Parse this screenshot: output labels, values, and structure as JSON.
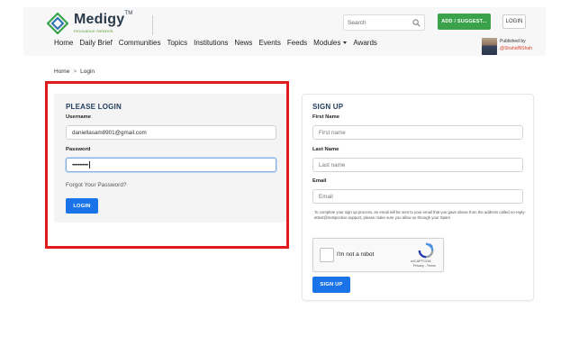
{
  "header": {
    "logo_name": "Medigy",
    "logo_tm": "TM",
    "logo_tagline": "Innovation Network",
    "search_placeholder": "Search",
    "add_button": "ADD / SUGGEST...",
    "login_button": "LOGIN",
    "nav": [
      "Home",
      "Daily Brief",
      "Communities",
      "Topics",
      "Institutions",
      "News",
      "Events",
      "Feeds",
      "Modules",
      "Awards"
    ],
    "published_by": "Published by",
    "author": "@ShahidNShah"
  },
  "breadcrumb": {
    "home": "Home",
    "separator": ">",
    "current": "Login"
  },
  "login": {
    "title": "PLEASE LOGIN",
    "username_label": "Username",
    "username_value": "daniellasam8901@gmail.com",
    "password_label": "Password",
    "password_value": "•••••••••••",
    "forgot_link": "Forgot Your Password?",
    "submit": "LOGIN"
  },
  "signup": {
    "title": "SIGN UP",
    "first_name_label": "First Name",
    "first_name_placeholder": "First name",
    "last_name_label": "Last Name",
    "last_name_placeholder": "Last name",
    "email_label": "Email",
    "email_placeholder": "Email",
    "note": "To complete your sign up process, an email will be sent to your email that you gave above from the address called no-reply-attest@netspective.support, please make sure you allow us through your Spam",
    "captcha_label": "I'm not a robot",
    "captcha_brand": "reCAPTCHA",
    "captcha_links": "Privacy - Terms",
    "submit": "SIGN UP"
  },
  "colors": {
    "accent_blue": "#1a73e8",
    "add_green": "#3aa24a",
    "highlight_red": "#e01b1b",
    "title_navy": "#1f3b5b"
  }
}
